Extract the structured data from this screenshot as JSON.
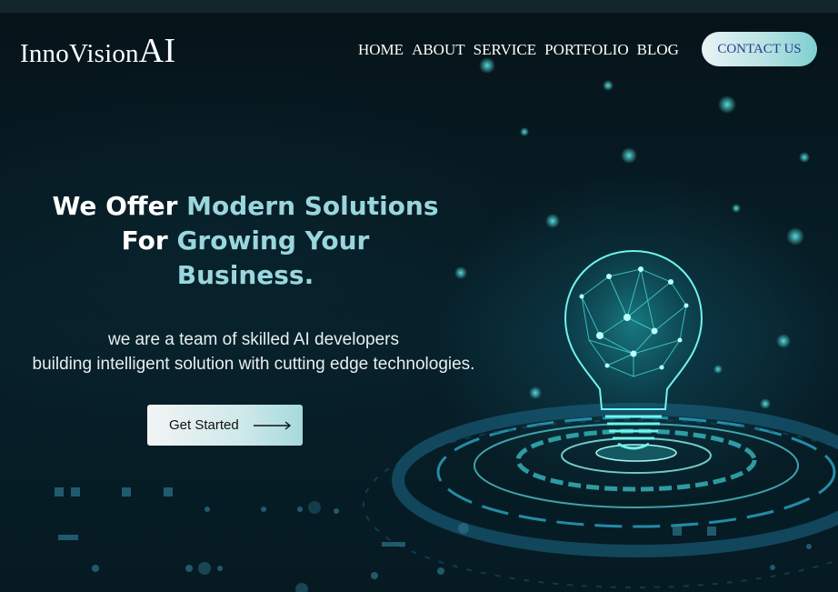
{
  "brand": {
    "name": "InnoVision",
    "suffix": "AI"
  },
  "nav": {
    "items": [
      "HOME",
      "ABOUT",
      "SERVICE",
      "PORTFOLIO",
      "BLOG"
    ],
    "contact_label": "CONTACT US"
  },
  "hero": {
    "headline": {
      "l1a": "We Offer ",
      "l1b": "Modern Solutions",
      "l2a": "For ",
      "l2b": "Growing Your",
      "l3": "Business."
    },
    "subtitle_1": "we are a team of skilled AI developers",
    "subtitle_2": "building intelligent solution with cutting edge technologies.",
    "cta_label": "Get Started"
  },
  "icons": {
    "arrow": "long-right-arrow-icon",
    "illustration": "lightbulb-icon"
  },
  "colors": {
    "background": "#071a20",
    "accent": "#9ad6dd",
    "contact_text": "#2a3b8c"
  }
}
